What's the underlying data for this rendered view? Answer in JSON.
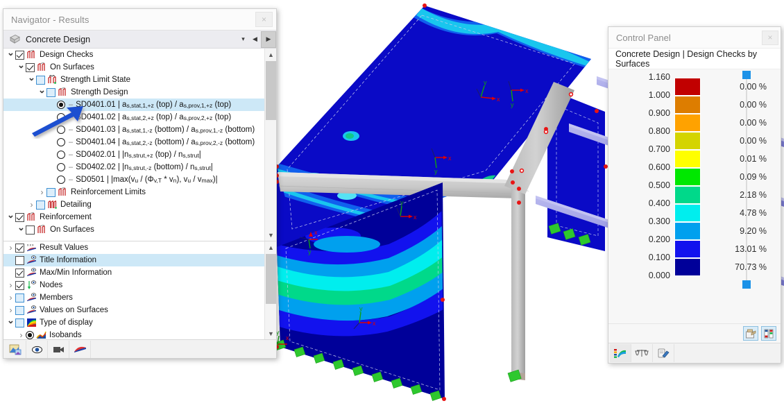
{
  "navigator": {
    "title": "Navigator - Results",
    "close_label": "×",
    "combo": {
      "value": "Concrete Design",
      "icon": "concrete-block-icon",
      "dropdown_icon": "chevron-down-icon",
      "prev_icon": "prev-arrow-icon",
      "next_icon": "next-arrow-icon"
    },
    "tree_top": [
      {
        "id": "design-checks",
        "indent": 0,
        "exp": "open",
        "ctrl": "checkbox",
        "state": "checked",
        "icon": "surface-design-icon",
        "label": "Design Checks"
      },
      {
        "id": "on-surfaces-1",
        "indent": 1,
        "exp": "open",
        "ctrl": "checkbox",
        "state": "checked",
        "icon": "surface-design-icon",
        "label": "On Surfaces"
      },
      {
        "id": "strength-limit-state",
        "indent": 2,
        "exp": "open",
        "ctrl": "checkbox",
        "state": "blue",
        "icon": "limit-state-icon",
        "label": "Strength Limit State"
      },
      {
        "id": "strength-design",
        "indent": 3,
        "exp": "open",
        "ctrl": "checkbox",
        "state": "blue",
        "icon": "surface-design-icon",
        "label": "Strength Design"
      },
      {
        "id": "sd0401-01",
        "indent": 4,
        "exp": "none",
        "ctrl": "radio",
        "state": "on",
        "icon": "none",
        "label": "SD0401.01 | as,stat,1,+z (top) / as,prov,1,+z (top)",
        "selected": true
      },
      {
        "id": "sd0401-02",
        "indent": 4,
        "exp": "none",
        "ctrl": "radio",
        "state": "off",
        "icon": "none",
        "label": "SD0401.02 | as,stat,2,+z (top) / as,prov,2,+z (top)"
      },
      {
        "id": "sd0401-03",
        "indent": 4,
        "exp": "none",
        "ctrl": "radio",
        "state": "off",
        "icon": "none",
        "label": "SD0401.03 | as,stat,1,-z (bottom) / as,prov,1,-z (bottom)"
      },
      {
        "id": "sd0401-04",
        "indent": 4,
        "exp": "none",
        "ctrl": "radio",
        "state": "off",
        "icon": "none",
        "label": "SD0401.04 | as,stat,2,-z (bottom) / as,prov,2,-z (bottom)"
      },
      {
        "id": "sd0402-01",
        "indent": 4,
        "exp": "none",
        "ctrl": "radio",
        "state": "off",
        "icon": "none",
        "label": "SD0402.01 | |ns,strut,+z (top) / ns,strut|"
      },
      {
        "id": "sd0402-02",
        "indent": 4,
        "exp": "none",
        "ctrl": "radio",
        "state": "off",
        "icon": "none",
        "label": "SD0402.02 | |ns,strut,-z (bottom) / ns,strut|"
      },
      {
        "id": "sd0501",
        "indent": 4,
        "exp": "none",
        "ctrl": "radio",
        "state": "off",
        "icon": "none",
        "label": "SD0501 | |max(vu / (Φv,T * vn), vu / vmax)|"
      },
      {
        "id": "reinforcement-limits",
        "indent": 3,
        "exp": "closed",
        "ctrl": "checkbox",
        "state": "blue",
        "icon": "surface-design-icon",
        "label": "Reinforcement Limits"
      },
      {
        "id": "detailing",
        "indent": 2,
        "exp": "closed",
        "ctrl": "checkbox",
        "state": "blue",
        "icon": "detailing-icon",
        "label": "Detailing"
      },
      {
        "id": "reinforcement",
        "indent": 0,
        "exp": "open",
        "ctrl": "checkbox",
        "state": "checked",
        "icon": "surface-design-icon",
        "label": "Reinforcement"
      },
      {
        "id": "on-surfaces-2",
        "indent": 1,
        "exp": "open",
        "ctrl": "checkbox",
        "state": "unchecked",
        "icon": "surface-design-icon",
        "label": "On Surfaces"
      }
    ],
    "tree_bottom": [
      {
        "id": "result-values",
        "indent": 0,
        "exp": "closed",
        "ctrl": "checkbox",
        "state": "checked",
        "icon": "result-values-icon",
        "label": "Result Values"
      },
      {
        "id": "title-information",
        "indent": 0,
        "exp": "none",
        "ctrl": "checkbox",
        "state": "unchecked",
        "icon": "info-label-icon",
        "label": "Title Information",
        "selected": true
      },
      {
        "id": "maxmin-information",
        "indent": 0,
        "exp": "none",
        "ctrl": "checkbox",
        "state": "checked",
        "icon": "info-label-icon",
        "label": "Max/Min Information"
      },
      {
        "id": "nodes",
        "indent": 0,
        "exp": "closed",
        "ctrl": "checkbox",
        "state": "checked",
        "icon": "node-icon",
        "label": "Nodes"
      },
      {
        "id": "members",
        "indent": 0,
        "exp": "closed",
        "ctrl": "checkbox",
        "state": "blue",
        "icon": "info-label-icon",
        "label": "Members"
      },
      {
        "id": "values-on-surfaces",
        "indent": 0,
        "exp": "closed",
        "ctrl": "checkbox",
        "state": "blue",
        "icon": "info-label-icon",
        "label": "Values on Surfaces"
      },
      {
        "id": "type-of-display",
        "indent": 0,
        "exp": "open",
        "ctrl": "checkbox",
        "state": "blue",
        "icon": "rainbow-icon",
        "label": "Type of display"
      },
      {
        "id": "isobands",
        "indent": 1,
        "exp": "closed",
        "ctrl": "radio",
        "state": "on",
        "icon": "isobands-icon",
        "label": "Isobands"
      }
    ],
    "toolbar": [
      {
        "id": "render-button",
        "icon": "render-view-icon"
      },
      {
        "id": "view-button",
        "icon": "eye-icon"
      },
      {
        "id": "camera-button",
        "icon": "video-camera-icon"
      },
      {
        "id": "diagram-button",
        "icon": "result-diagram-icon"
      }
    ]
  },
  "control_panel": {
    "title": "Control Panel",
    "close_label": "×",
    "subtitle": "Concrete Design | Design Checks by Surfaces",
    "legend": {
      "values": [
        "1.160",
        "1.000",
        "0.900",
        "0.800",
        "0.700",
        "0.600",
        "0.500",
        "0.400",
        "0.300",
        "0.200",
        "0.100",
        "0.000"
      ],
      "colors": [
        "#c10000",
        "#dd7d00",
        "#ffa200",
        "#d4d400",
        "#ffff00",
        "#00e800",
        "#00d98a",
        "#00eeee",
        "#00a0ee",
        "#1212ee",
        "#000099"
      ],
      "percents": [
        "0.00 %",
        "0.00 %",
        "0.00 %",
        "0.00 %",
        "0.01 %",
        "0.09 %",
        "2.18 %",
        "4.78 %",
        "9.20 %",
        "13.01 %",
        "70.73 %"
      ],
      "slider_color": "#1c92e8"
    },
    "mid_buttons": [
      {
        "id": "print-legend-button",
        "icon": "print-legend-icon"
      },
      {
        "id": "edit-scale-button",
        "icon": "color-scale-edit-icon"
      }
    ],
    "bottom_tabs": [
      {
        "id": "color-scale-tab",
        "icon": "color-spectrum-icon",
        "active": true
      },
      {
        "id": "factors-tab",
        "icon": "scales-balance-icon",
        "active": false
      },
      {
        "id": "display-props-tab",
        "icon": "properties-pen-icon",
        "active": false
      }
    ]
  },
  "viewport": {
    "axis_labels": {
      "x": "x",
      "y": "y",
      "z": "z"
    },
    "colors": {
      "slab_primary": "#0a0ac6",
      "slab_secondary": "#0b3ae0",
      "slab_cyan": "#12d9ee",
      "slab_green": "#12c98a",
      "beam_grey": "#c3c3c3",
      "member_purple": "#9a9ae8",
      "support_green": "#2ec82e",
      "node_red": "#e81414"
    },
    "annotation_arrow_color": "#1a4fd0"
  }
}
